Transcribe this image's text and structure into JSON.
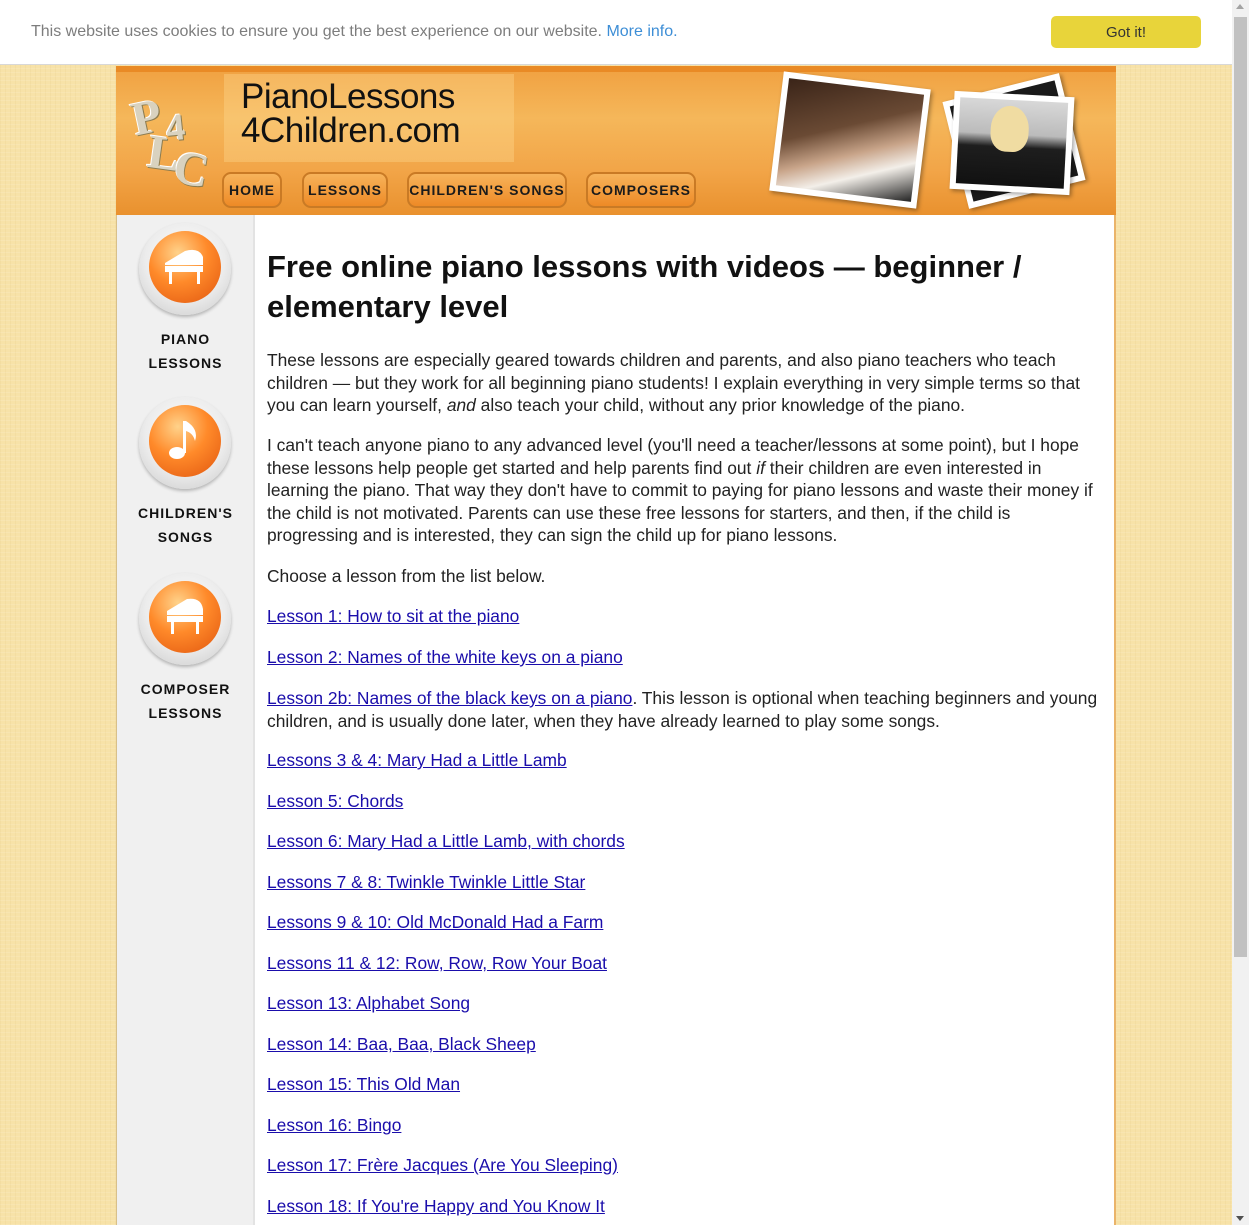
{
  "cookie": {
    "message": "This website uses cookies to ensure you get the best experience on our website.",
    "more_info": "More info.",
    "button": "Got it!"
  },
  "header": {
    "logo_letters": [
      "P",
      "L",
      "4",
      "C"
    ],
    "site_name_line1": "PianoLessons",
    "site_name_line2": "4Children.com",
    "nav": [
      "HOME",
      "LESSONS",
      "CHILDREN'S SONGS",
      "COMPOSERS"
    ]
  },
  "sidebar": [
    {
      "line1": "PIANO",
      "line2": "LESSONS"
    },
    {
      "line1": "CHILDREN'S",
      "line2": "SONGS"
    },
    {
      "line1": "COMPOSER",
      "line2": "LESSONS"
    }
  ],
  "main": {
    "title": "Free online piano lessons with videos — beginner / elementary level",
    "intro_part1": "These lessons are especially geared towards children and parents, and also piano teachers who teach children — but they work for all beginning piano students! I explain everything in very simple terms so that you can learn yourself, ",
    "intro_em": "and",
    "intro_part2": " also teach your child, without any prior knowledge of the piano.",
    "second_part1": "I can't teach anyone piano to any advanced level (you'll need a teacher/lessons at some point), but I hope these lessons help people get started and help parents find out ",
    "second_em": "if",
    "second_part2": " their children are even interested in learning the piano. That way they don't have to commit to paying for piano lessons and waste their money if the child is not motivated. Parents can use these free lessons for starters, and then, if the child is progressing and is interested, they can sign the child up for piano lessons.",
    "choose": "Choose a lesson from the list below.",
    "lesson2b_note": ". This lesson is optional when teaching beginners and young children, and is usually done later, when they have already learned to play some songs.",
    "lessons": [
      "Lesson 1: How to sit at the piano",
      "Lesson 2: Names of the white keys on a piano",
      "Lesson 2b: Names of the black keys on a piano",
      "Lessons 3 & 4: Mary Had a Little Lamb",
      "Lesson 5: Chords",
      "Lesson 6: Mary Had a Little Lamb, with chords",
      "Lessons 7 & 8: Twinkle Twinkle Little Star",
      "Lessons 9 & 10: Old McDonald Had a Farm",
      "Lessons 11 & 12: Row, Row, Row Your Boat",
      "Lesson 13: Alphabet Song",
      "Lesson 14: Baa, Baa, Black Sheep",
      "Lesson 15: This Old Man",
      "Lesson 16: Bingo",
      "Lesson 17: Frère Jacques (Are You Sleeping)",
      "Lesson 18: If You're Happy and You Know It"
    ]
  },
  "colors": {
    "link": "#1a0dab",
    "cookie_button": "#e8d43a",
    "nav_orange": "#ee8a26",
    "background": "#f7e2a8"
  }
}
